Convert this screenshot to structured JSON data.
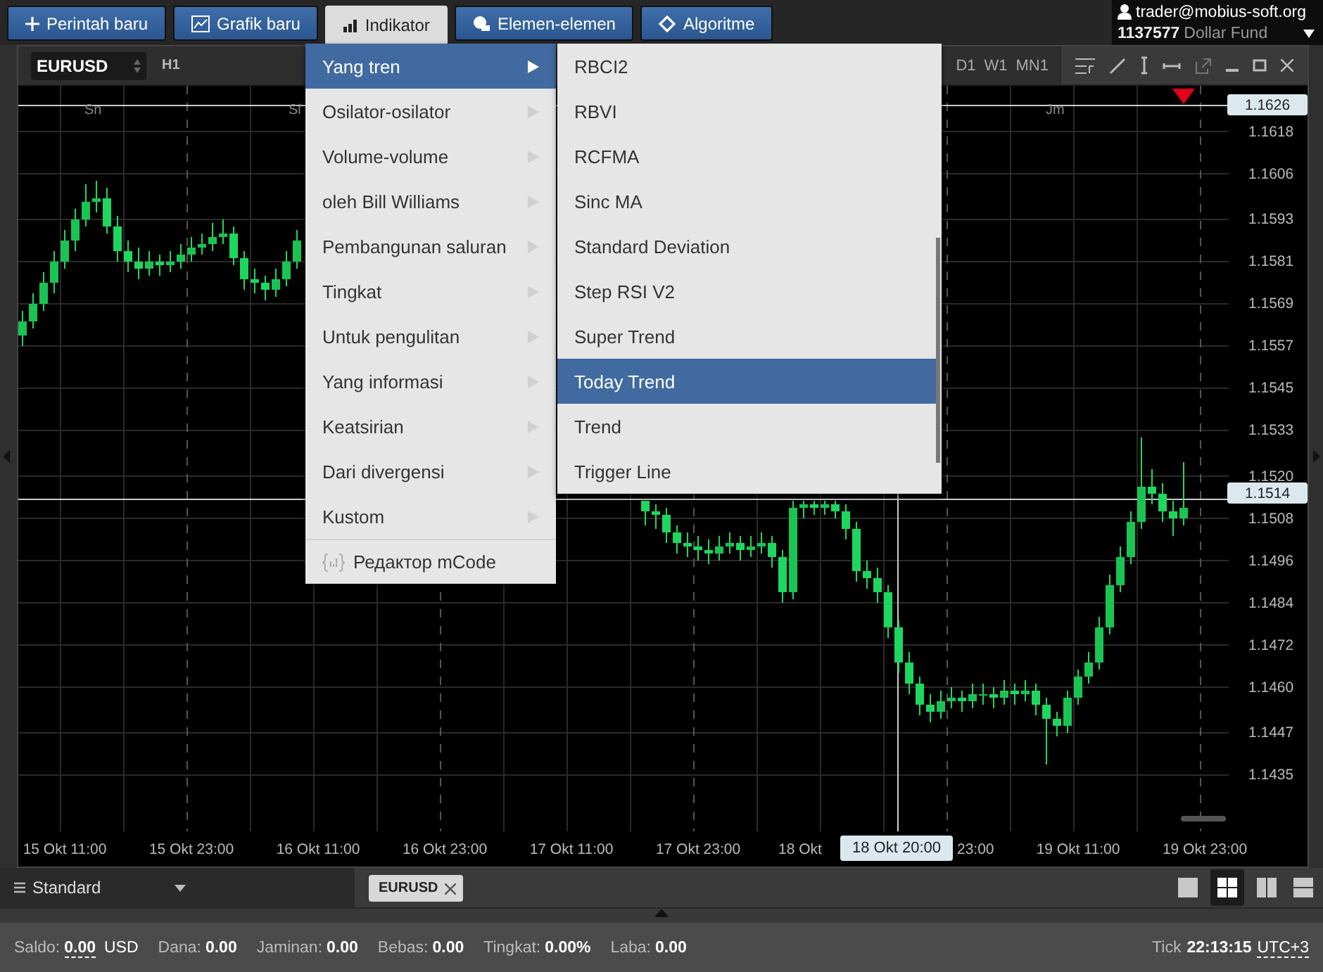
{
  "toolbar": {
    "buttons": [
      {
        "label": "Perintah baru",
        "selected": false
      },
      {
        "label": "Grafik baru",
        "selected": false
      },
      {
        "label": "Indikator",
        "selected": true
      },
      {
        "label": "Elemen-elemen",
        "selected": false
      },
      {
        "label": "Algoritme",
        "selected": false
      }
    ]
  },
  "account": {
    "user": "trader@mobius-soft.org",
    "number": "1137577",
    "name": "Dollar Fund"
  },
  "chart_window": {
    "symbol": "EURUSD",
    "timeframe": "H1",
    "timeframes": [
      "D1",
      "W1",
      "MN1"
    ],
    "day_labels": [
      "Sn",
      "Sl",
      "Jm"
    ],
    "price_markers": [
      "1.1626",
      "1.1514"
    ],
    "cut_time_labels": [
      "18 Okt",
      "23:00"
    ],
    "crosshair_time": "18 Okt 20:00",
    "chart_data": {
      "type": "candlestick",
      "ylim": [
        1.1419,
        1.1631
      ],
      "grid": true,
      "categories": [
        null,
        null,
        null,
        null,
        "15 Okt 11:00",
        null,
        null,
        null,
        null,
        null,
        null,
        null,
        null,
        null,
        null,
        null,
        "15 Okt 23:00",
        null,
        null,
        null,
        null,
        null,
        null,
        null,
        null,
        null,
        null,
        null,
        "16 Okt 11:00",
        null,
        null,
        null,
        null,
        null,
        null,
        null,
        null,
        null,
        null,
        null,
        "16 Okt 23:00",
        null,
        null,
        null,
        null,
        null,
        null,
        null,
        null,
        null,
        null,
        null,
        "17 Okt 11:00",
        null,
        null,
        null,
        null,
        null,
        null,
        null,
        null,
        null,
        null,
        null,
        "17 Okt 23:00",
        null,
        null,
        null,
        null,
        null,
        null,
        null,
        null,
        null,
        null,
        null,
        null,
        null,
        null,
        null,
        null,
        null,
        null,
        null,
        null,
        null,
        null,
        null,
        null,
        null,
        null,
        null,
        null,
        null,
        null,
        null,
        null,
        null,
        null,
        null,
        "19 Okt 11:00",
        null,
        null,
        null,
        null,
        null,
        null,
        null,
        null,
        null,
        null,
        null,
        "19 Okt 23:00"
      ],
      "yticks": [
        {
          "value": 1.1618,
          "label": "1.1618"
        },
        {
          "value": 1.1606,
          "label": "1.1606"
        },
        {
          "value": 1.1593,
          "label": "1.1593"
        },
        {
          "value": 1.1581,
          "label": "1.1581"
        },
        {
          "value": 1.1569,
          "label": "1.1569"
        },
        {
          "value": 1.1557,
          "label": "1.1557"
        },
        {
          "value": 1.1545,
          "label": "1.1545"
        },
        {
          "value": 1.1533,
          "label": "1.1533"
        },
        {
          "value": 1.152,
          "label": "1.1520"
        },
        {
          "value": 1.1508,
          "label": "1.1508"
        },
        {
          "value": 1.1496,
          "label": "1.1496"
        },
        {
          "value": 1.1484,
          "label": "1.1484"
        },
        {
          "value": 1.1472,
          "label": "1.1472"
        },
        {
          "value": 1.146,
          "label": "1.1460"
        },
        {
          "value": 1.1447,
          "label": "1.1447"
        },
        {
          "value": 1.1435,
          "label": "1.1435"
        }
      ],
      "ohlc": [
        [
          1.156,
          1.1567,
          1.1557,
          1.1564
        ],
        [
          1.1564,
          1.1572,
          1.1562,
          1.1569
        ],
        [
          1.1569,
          1.1578,
          1.1567,
          1.1575
        ],
        [
          1.1575,
          1.1584,
          1.1572,
          1.1581
        ],
        [
          1.1581,
          1.159,
          1.1579,
          1.1587
        ],
        [
          1.1587,
          1.1596,
          1.1584,
          1.1593
        ],
        [
          1.1593,
          1.1603,
          1.1591,
          1.1598
        ],
        [
          1.1598,
          1.1604,
          1.1595,
          1.1599
        ],
        [
          1.1599,
          1.1602,
          1.1589,
          1.1591
        ],
        [
          1.1591,
          1.1594,
          1.1581,
          1.1584
        ],
        [
          1.1584,
          1.1587,
          1.1578,
          1.1581
        ],
        [
          1.1581,
          1.1585,
          1.1576,
          1.1579
        ],
        [
          1.1579,
          1.1584,
          1.1577,
          1.1581
        ],
        [
          1.1581,
          1.1583,
          1.1577,
          1.158
        ],
        [
          1.158,
          1.1584,
          1.1578,
          1.1581
        ],
        [
          1.1581,
          1.1586,
          1.1579,
          1.1583
        ],
        [
          1.1583,
          1.1588,
          1.1581,
          1.1585
        ],
        [
          1.1585,
          1.1589,
          1.1583,
          1.1586
        ],
        [
          1.1586,
          1.1592,
          1.1584,
          1.1588
        ],
        [
          1.1588,
          1.1593,
          1.1586,
          1.1589
        ],
        [
          1.1589,
          1.1591,
          1.158,
          1.1582
        ],
        [
          1.1582,
          1.1584,
          1.1573,
          1.1576
        ],
        [
          1.1576,
          1.1579,
          1.1572,
          1.1575
        ],
        [
          1.1575,
          1.1577,
          1.157,
          1.1573
        ],
        [
          1.1573,
          1.1579,
          1.1571,
          1.1576
        ],
        [
          1.1576,
          1.1584,
          1.1574,
          1.1581
        ],
        [
          1.1581,
          1.159,
          1.1579,
          1.1587
        ],
        null,
        null,
        null,
        null,
        null,
        null,
        null,
        null,
        null,
        null,
        null,
        null,
        null,
        null,
        null,
        null,
        null,
        null,
        null,
        null,
        null,
        null,
        null,
        null,
        null,
        null,
        null,
        null,
        null,
        null,
        null,
        null,
        [
          1.1513,
          1.1513,
          1.1506,
          1.151
        ],
        [
          1.151,
          1.1512,
          1.1505,
          1.1509
        ],
        [
          1.1509,
          1.1511,
          1.1501,
          1.1504
        ],
        [
          1.1504,
          1.1506,
          1.1498,
          1.1501
        ],
        [
          1.1501,
          1.1504,
          1.1497,
          1.15
        ],
        [
          1.15,
          1.1503,
          1.1496,
          1.1499
        ],
        [
          1.1499,
          1.1502,
          1.1495,
          1.1498
        ],
        [
          1.1498,
          1.1503,
          1.1496,
          1.15
        ],
        [
          1.15,
          1.1504,
          1.1498,
          1.1501
        ],
        [
          1.1501,
          1.1503,
          1.1496,
          1.1499
        ],
        [
          1.1499,
          1.1503,
          1.1497,
          1.15
        ],
        [
          1.15,
          1.1504,
          1.1498,
          1.1501
        ],
        [
          1.1501,
          1.1503,
          1.1494,
          1.1497
        ],
        [
          1.1497,
          1.1499,
          1.1484,
          1.1487
        ],
        [
          1.1487,
          1.1513,
          1.1485,
          1.1511
        ],
        [
          1.1511,
          1.1513,
          1.1508,
          1.1512
        ],
        [
          1.1512,
          1.1513,
          1.1509,
          1.1511
        ],
        [
          1.1511,
          1.1513,
          1.1509,
          1.1512
        ],
        [
          1.1512,
          1.1513,
          1.1508,
          1.151
        ],
        [
          1.151,
          1.1512,
          1.1502,
          1.1505
        ],
        [
          1.1505,
          1.1507,
          1.149,
          1.1493
        ],
        [
          1.1493,
          1.1496,
          1.1488,
          1.1491
        ],
        [
          1.1491,
          1.1494,
          1.1484,
          1.1487
        ],
        [
          1.1487,
          1.1489,
          1.1474,
          1.1477
        ],
        [
          1.1477,
          1.1479,
          1.1464,
          1.1467
        ],
        [
          1.1467,
          1.147,
          1.1458,
          1.1461
        ],
        [
          1.1461,
          1.1463,
          1.1452,
          1.1455
        ],
        [
          1.1455,
          1.1458,
          1.145,
          1.1453
        ],
        [
          1.1453,
          1.1459,
          1.1451,
          1.1456
        ],
        [
          1.1456,
          1.146,
          1.1454,
          1.1457
        ],
        [
          1.1457,
          1.1459,
          1.1453,
          1.1456
        ],
        [
          1.1456,
          1.1461,
          1.1454,
          1.1458
        ],
        [
          1.1458,
          1.1461,
          1.1455,
          1.1458
        ],
        [
          1.1458,
          1.146,
          1.1454,
          1.1457
        ],
        [
          1.1457,
          1.1462,
          1.1455,
          1.1459
        ],
        [
          1.1459,
          1.1461,
          1.1455,
          1.1458
        ],
        [
          1.1458,
          1.1462,
          1.1456,
          1.1459
        ],
        [
          1.1459,
          1.1461,
          1.1452,
          1.1455
        ],
        [
          1.1455,
          1.1457,
          1.1438,
          1.1451
        ],
        [
          1.1451,
          1.1453,
          1.1446,
          1.1449
        ],
        [
          1.1449,
          1.1459,
          1.1447,
          1.1457
        ],
        [
          1.1457,
          1.1465,
          1.1455,
          1.1463
        ],
        [
          1.1463,
          1.147,
          1.1461,
          1.1467
        ],
        [
          1.1467,
          1.148,
          1.1465,
          1.1477
        ],
        [
          1.1477,
          1.1492,
          1.1475,
          1.1489
        ],
        [
          1.1489,
          1.15,
          1.1487,
          1.1497
        ],
        [
          1.1497,
          1.151,
          1.1495,
          1.1507
        ],
        [
          1.1507,
          1.1531,
          1.1505,
          1.1517
        ],
        [
          1.1517,
          1.1522,
          1.1512,
          1.1515
        ],
        [
          1.1515,
          1.1518,
          1.1507,
          1.151
        ],
        [
          1.151,
          1.1513,
          1.1503,
          1.1508
        ],
        [
          1.1508,
          1.1524,
          1.1506,
          1.1511
        ],
        null,
        null
      ]
    }
  },
  "indicator_menu": {
    "items": [
      {
        "label": "Yang tren",
        "selected": true
      },
      {
        "label": "Osilator-osilator",
        "selected": false
      },
      {
        "label": "Volume-volume",
        "selected": false
      },
      {
        "label": "oleh Bill Williams",
        "selected": false
      },
      {
        "label": "Pembangunan saluran",
        "selected": false
      },
      {
        "label": "Tingkat",
        "selected": false
      },
      {
        "label": "Untuk pengulitan",
        "selected": false
      },
      {
        "label": "Yang informasi",
        "selected": false
      },
      {
        "label": "Keatsirian",
        "selected": false
      },
      {
        "label": "Dari divergensi",
        "selected": false
      },
      {
        "label": "Kustom",
        "selected": false
      }
    ],
    "footer": "Редактор mCode"
  },
  "submenu": {
    "items": [
      {
        "label": "RBCI2",
        "selected": false
      },
      {
        "label": "RBVI",
        "selected": false
      },
      {
        "label": "RCFMA",
        "selected": false
      },
      {
        "label": "Sinc MA",
        "selected": false
      },
      {
        "label": "Standard Deviation",
        "selected": false
      },
      {
        "label": "Step RSI V2",
        "selected": false
      },
      {
        "label": "Super Trend",
        "selected": false
      },
      {
        "label": "Today Trend",
        "selected": true
      },
      {
        "label": "Trend",
        "selected": false
      },
      {
        "label": "Trigger Line",
        "selected": false
      }
    ]
  },
  "bottom_bar": {
    "template": "Standard",
    "tabs": [
      {
        "label": "EURUSD"
      }
    ],
    "layouts": [
      {
        "kind": "single",
        "selected": false
      },
      {
        "kind": "grid",
        "selected": true
      },
      {
        "kind": "columns",
        "selected": false
      },
      {
        "kind": "rows",
        "selected": false
      }
    ]
  },
  "status_bar": {
    "fields": [
      {
        "label": "Saldo:",
        "value": "0.00",
        "unit": "USD"
      },
      {
        "label": "Dana:",
        "value": "0.00"
      },
      {
        "label": "Jaminan:",
        "value": "0.00"
      },
      {
        "label": "Bebas:",
        "value": "0.00"
      },
      {
        "label": "Tingkat:",
        "value": "0.00%"
      },
      {
        "label": "Laba:",
        "value": "0.00"
      }
    ],
    "tick_label": "Tick",
    "time": "22:13:15",
    "timezone": "UTC+3"
  }
}
